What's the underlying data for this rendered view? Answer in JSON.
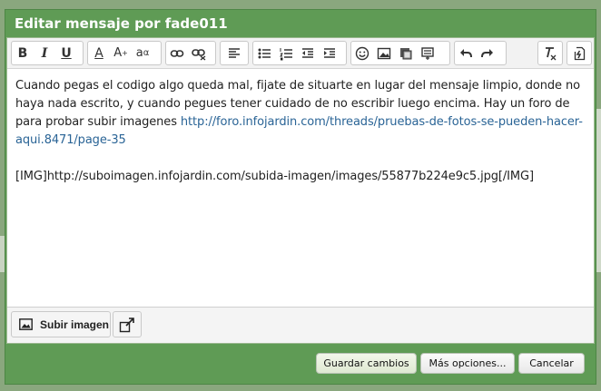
{
  "dialog": {
    "title": "Editar mensaje por fade011"
  },
  "toolbar": {
    "bold_label": "B",
    "italic_label": "I",
    "underline_label": "U",
    "font_color_label": "A",
    "font_size_label": "A",
    "font_family_label": "a"
  },
  "content": {
    "paragraph_text": "Cuando pegas el codigo algo queda mal, fijate de situarte en lugar del mensaje limpio, donde no haya nada escrito, y cuando pegues tener cuidado de no escribir luego encima. Hay un foro de para probar subir imagenes ",
    "link_text": "http://foro.infojardin.com/threads/pruebas-de-fotos-se-pueden-hacer-aqui.8471/page-35",
    "img_code": "[IMG]http://suboimagen.infojardin.com/subida-imagen/images/55877b224e9c5.jpg[/IMG]"
  },
  "attachments": {
    "upload_label": "Subir imagen"
  },
  "footer": {
    "save_label": "Guardar cambios",
    "more_label": "Más opciones...",
    "cancel_label": "Cancelar"
  }
}
